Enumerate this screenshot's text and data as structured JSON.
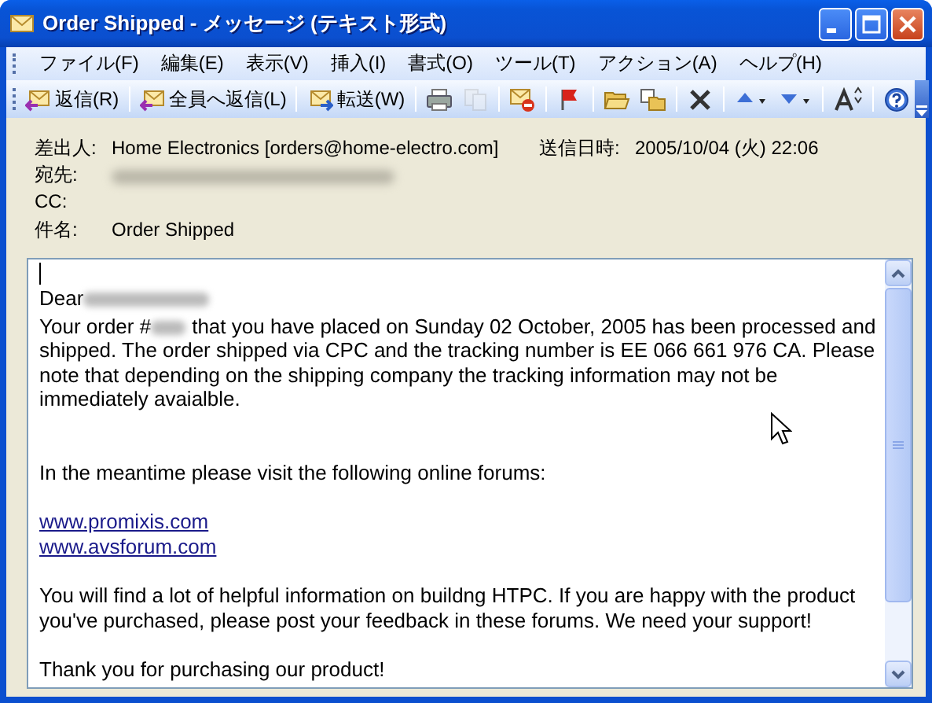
{
  "window": {
    "title": "Order Shipped - メッセージ (テキスト形式)"
  },
  "menu": [
    "ファイル(F)",
    "編集(E)",
    "表示(V)",
    "挿入(I)",
    "書式(O)",
    "ツール(T)",
    "アクション(A)",
    "ヘルプ(H)"
  ],
  "toolbar": {
    "labeled": [
      {
        "label": "返信(R)"
      },
      {
        "label": "全員へ返信(L)"
      },
      {
        "label": "転送(W)"
      }
    ],
    "icon_buttons": [
      {
        "disabled": false
      },
      {
        "disabled": true
      },
      {
        "disabled": false
      },
      {
        "disabled": false
      },
      {
        "disabled": false
      },
      {
        "disabled": false
      },
      {
        "disabled": false
      },
      {
        "disabled": false
      },
      {
        "disabled": false
      },
      {
        "disabled": false
      },
      {
        "disabled": false
      }
    ]
  },
  "header": {
    "from": {
      "label": "差出人:",
      "value": "Home Electronics [orders@home-electro.com]"
    },
    "sent": {
      "label": "送信日時:",
      "value": "2005/10/04 (火) 22:06"
    },
    "to": {
      "label": "宛先:",
      "redacted": true
    },
    "cc": {
      "label": "CC:"
    },
    "subject": {
      "label": "件名:",
      "value": "Order Shipped"
    }
  },
  "body": [
    {
      "kind": "greeting",
      "parts": [
        {
          "kind": "text",
          "text": "Dear"
        },
        {
          "kind": "redacted"
        }
      ]
    },
    {
      "kind": "paragraph",
      "parts": [
        {
          "kind": "text",
          "text": "Your order #"
        },
        {
          "kind": "redacted"
        },
        {
          "kind": "text",
          "text": "that you have placed on Sunday 02 October, 2005 has been processed and"
        },
        {
          "kind": "continuation",
          "text": "shipped. The order shipped via CPC and the tracking number is EE 066 661 976 CA. Please note that depending on the shipping company the tracking  information may not be immediately avaialble."
        }
      ]
    },
    {
      "kind": "paragraph",
      "parts": [
        {
          "kind": "text",
          "text": "In the meantime please visit the following online forums:"
        }
      ]
    },
    {
      "kind": "links",
      "parts": [
        {
          "kind": "link",
          "text": "www.promixis.com"
        },
        {
          "kind": "link",
          "text": "www.avsforum.com"
        }
      ]
    },
    {
      "kind": "paragraph",
      "parts": [
        {
          "kind": "text",
          "text": "You will find a lot of helpful information on buildng HTPC. If you are happy with the product you've purchased, please post your feedback in these forums. We need your support!"
        }
      ]
    },
    {
      "kind": "paragraph",
      "parts": [
        {
          "kind": "text",
          "text": "Thank you for purchasing our product!"
        }
      ]
    }
  ]
}
